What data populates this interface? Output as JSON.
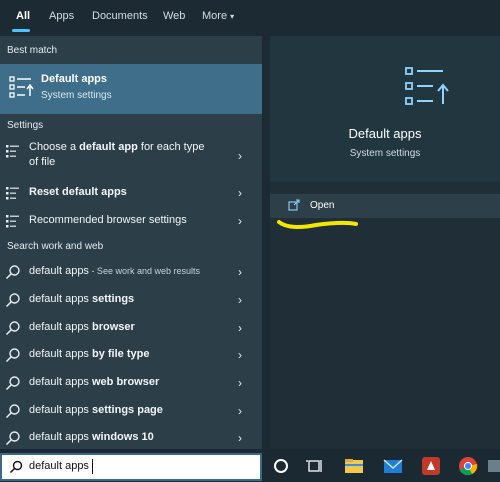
{
  "tabs": {
    "all": "All",
    "apps": "Apps",
    "documents": "Documents",
    "web": "Web",
    "more": "More",
    "more_caret": "▾"
  },
  "sections": {
    "best_match": "Best match",
    "settings": "Settings",
    "search_web": "Search work and web"
  },
  "best_match": {
    "title": "Default apps",
    "subtitle": "System settings"
  },
  "settings_items": [
    {
      "line1_pre": "Choose a ",
      "line1_bold": "default app",
      "line1_post": " for each type",
      "line2": "of file"
    },
    {
      "bold": "Reset default apps"
    },
    {
      "label": "Recommended browser settings"
    }
  ],
  "web_items": [
    {
      "pre": "default apps",
      "bold": "",
      "suffix": " - See work and web results"
    },
    {
      "pre": "default apps",
      "bold": " settings",
      "suffix": ""
    },
    {
      "pre": "default apps",
      "bold": " browser",
      "suffix": ""
    },
    {
      "pre": "default apps",
      "bold": " by file type",
      "suffix": ""
    },
    {
      "pre": "default apps",
      "bold": " web browser",
      "suffix": ""
    },
    {
      "pre": "default apps",
      "bold": " settings page",
      "suffix": ""
    },
    {
      "pre": "default apps",
      "bold": " windows 10",
      "suffix": ""
    }
  ],
  "chevron": "›",
  "detail": {
    "title": "Default apps",
    "subtitle": "System settings",
    "open_label": "Open"
  },
  "search": {
    "value": "default apps"
  },
  "colors": {
    "accent": "#4cc2ff",
    "selected": "#3e6e8a",
    "highlight": "#f5e800"
  }
}
